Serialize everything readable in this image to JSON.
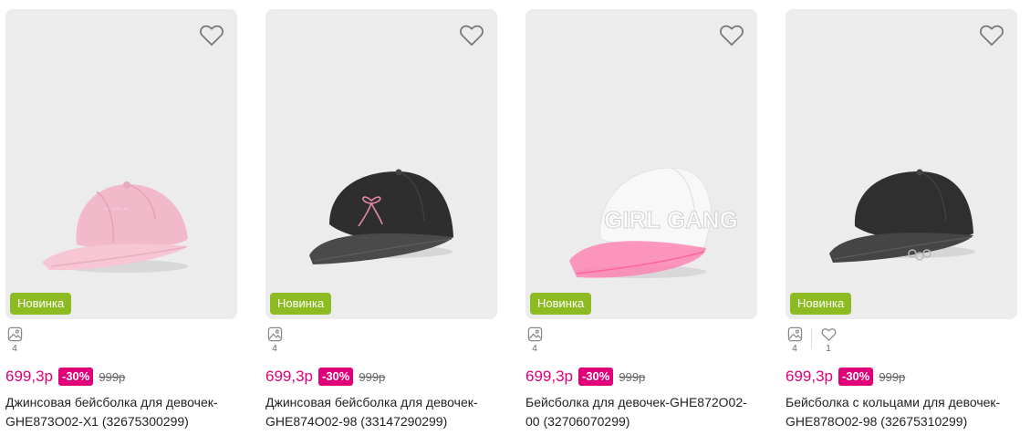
{
  "colors": {
    "price": "#e0007a",
    "discount_bg": "#e0007a",
    "badge_new_bg": "#8dbb22",
    "image_bg": "#ececec"
  },
  "products": [
    {
      "badge": "Новинка",
      "photos_count": "4",
      "likes_count": "",
      "price": "699,3р",
      "discount": "-30%",
      "old_price": "999р",
      "title_line1": "Джинсовая бейсболка для девочек-",
      "title_line2": "GHE873O02-X1 (32675300299)",
      "cap_icon": "pink-cap-image"
    },
    {
      "badge": "Новинка",
      "photos_count": "4",
      "likes_count": "",
      "price": "699,3р",
      "discount": "-30%",
      "old_price": "999р",
      "title_line1": "Джинсовая бейсболка для девочек-",
      "title_line2": "GHE874O02-98 (33147290299)",
      "cap_icon": "gray-cap-with-bow-image"
    },
    {
      "badge": "Новинка",
      "photos_count": "4",
      "likes_count": "",
      "price": "699,3р",
      "discount": "-30%",
      "old_price": "999р",
      "title_line1": "Бейсболка для девочек-GHE872O02-",
      "title_line2": "00 (32706070299)",
      "cap_icon": "white-cap-pink-visor-image"
    },
    {
      "badge": "Новинка",
      "photos_count": "4",
      "likes_count": "1",
      "price": "699,3р",
      "discount": "-30%",
      "old_price": "999р",
      "title_line1": "Бейсболка с кольцами для девочек-",
      "title_line2": "GHE878O02-98 (32675310299)",
      "cap_icon": "gray-cap-with-rings-image"
    }
  ]
}
